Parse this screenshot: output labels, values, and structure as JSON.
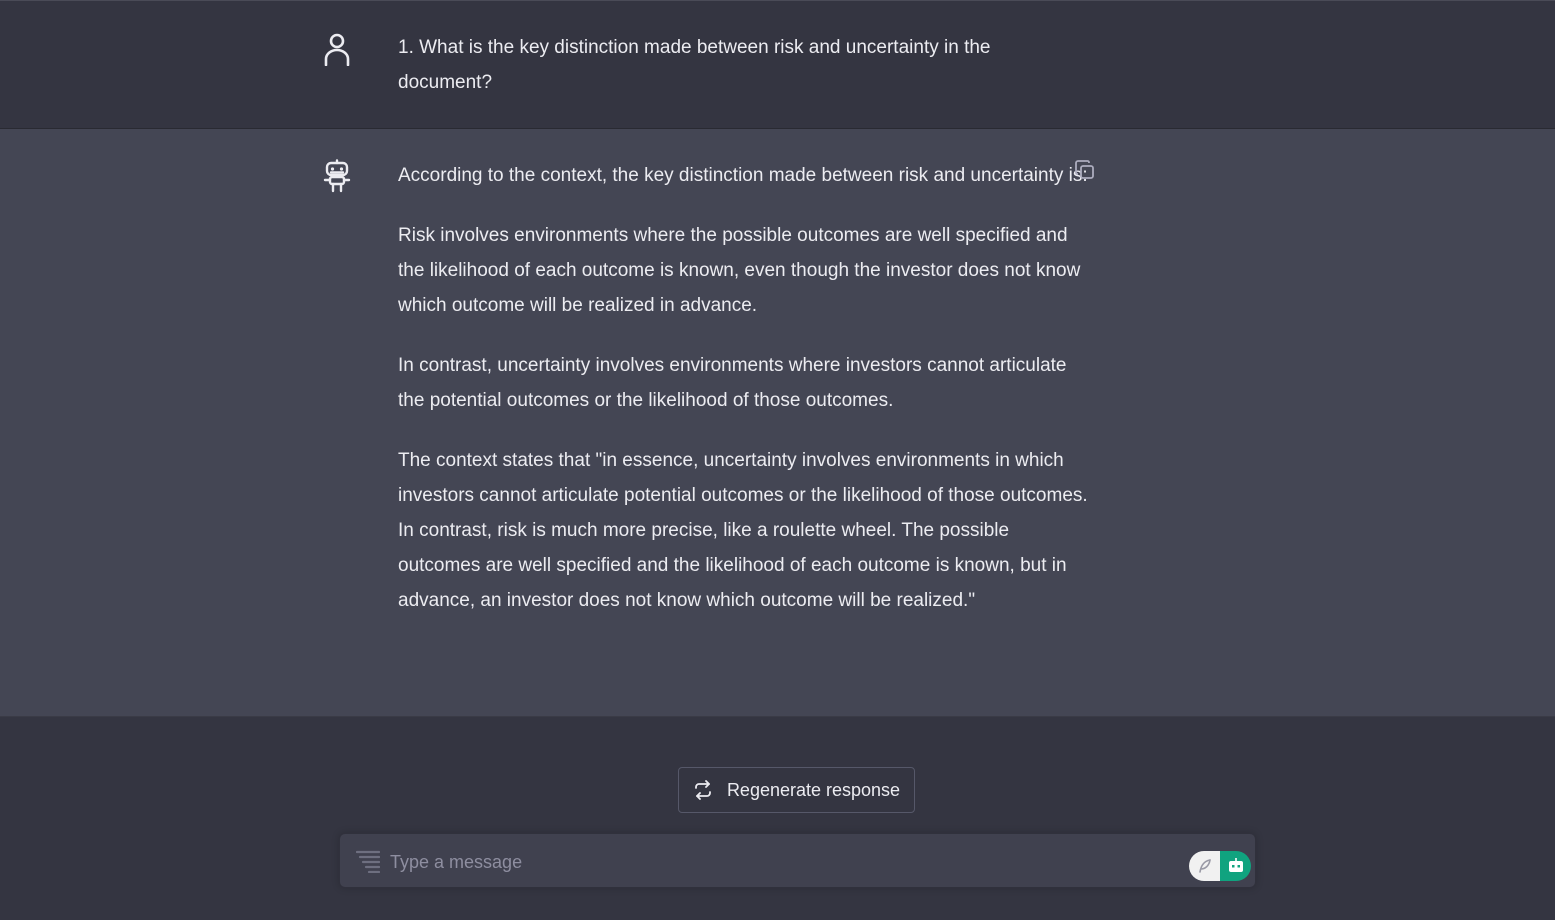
{
  "conversation": {
    "user_message": {
      "avatar_icon": "user-icon",
      "text": "1. What is the key distinction made between risk and uncertainty in the document?"
    },
    "bot_message": {
      "avatar_icon": "robot-icon",
      "paragraphs": [
        "According to the context, the key distinction made between risk and uncertainty is:",
        "Risk involves environments where the possible outcomes are well specified and the likelihood of each outcome is known, even though the investor does not know which outcome will be realized in advance.",
        "In contrast, uncertainty involves environments where investors cannot articulate the potential outcomes or the likelihood of those outcomes.",
        "The context states that \"in essence, uncertainty involves environments in which investors cannot articulate potential outcomes or the likelihood of those outcomes. In contrast, risk is much more precise, like a roulette wheel. The possible outcomes are well specified and the likelihood of each outcome is known, but in advance, an investor does not know which outcome will be realized.\""
      ],
      "copy_icon": "copy-icon"
    }
  },
  "actions": {
    "regenerate_label": "Regenerate response",
    "regenerate_icon": "refresh-icon"
  },
  "composer": {
    "value": "",
    "placeholder": "Type a message",
    "left_icon": "prompt-lines-icon",
    "extension_icons": [
      "feather-icon",
      "robot-extension-icon"
    ]
  },
  "colors": {
    "page_bg": "#343541",
    "bot_bg": "#444654",
    "input_bg": "#40414f",
    "accent": "#10a37f",
    "text": "#ececf1",
    "placeholder": "#8e8ea0"
  }
}
